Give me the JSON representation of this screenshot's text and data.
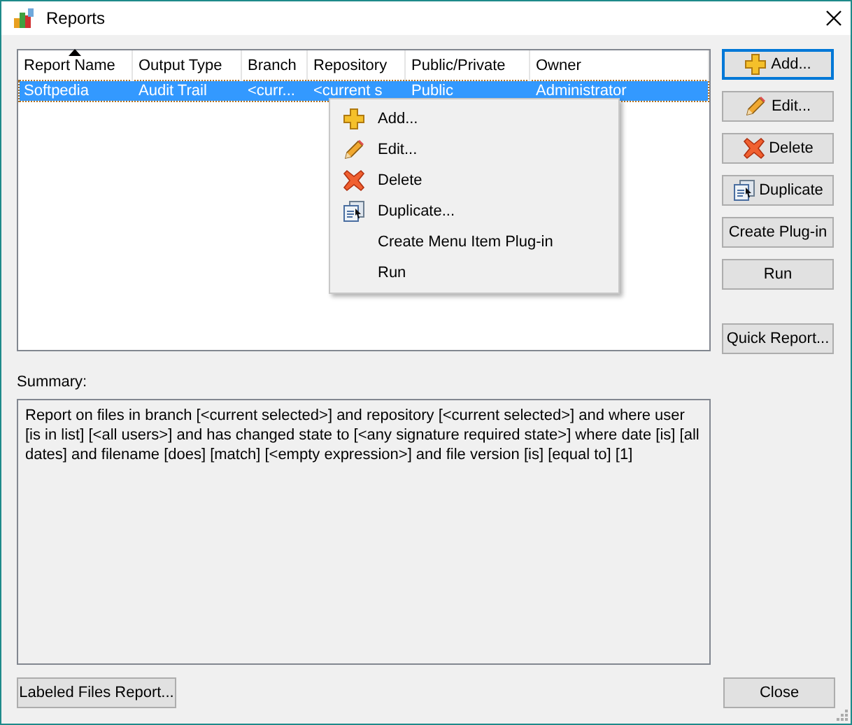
{
  "window": {
    "title": "Reports"
  },
  "table": {
    "columns": [
      {
        "label": "Report Name",
        "sorted": true
      },
      {
        "label": "Output Type",
        "sorted": false
      },
      {
        "label": "Branch",
        "sorted": false
      },
      {
        "label": "Repository",
        "sorted": false
      },
      {
        "label": "Public/Private",
        "sorted": false
      },
      {
        "label": "Owner",
        "sorted": false
      }
    ],
    "rows": [
      {
        "selected": true,
        "cells": [
          "Softpedia",
          "Audit Trail",
          "<curr...",
          "<current s",
          "Public",
          "Administrator"
        ]
      }
    ]
  },
  "context_menu": [
    {
      "label": "Add...",
      "kind": "add"
    },
    {
      "label": "Edit...",
      "kind": "edit"
    },
    {
      "label": "Delete",
      "kind": "delete"
    },
    {
      "label": "Duplicate...",
      "kind": "duplicate"
    },
    {
      "label": "Create Menu Item Plug-in",
      "kind": "plain"
    },
    {
      "label": "Run",
      "kind": "plain"
    }
  ],
  "side_buttons": [
    {
      "label": "Add...",
      "kind": "add",
      "focused": true
    },
    {
      "label": "Edit...",
      "kind": "edit",
      "focused": false
    },
    {
      "label": "Delete",
      "kind": "delete",
      "focused": false
    },
    {
      "label": "Duplicate",
      "kind": "duplicate",
      "focused": false
    },
    {
      "label": "Create Plug-in",
      "kind": "plain",
      "focused": false
    },
    {
      "label": "Run",
      "kind": "plain",
      "focused": false
    },
    {
      "label": "Quick Report...",
      "kind": "spaced",
      "focused": false
    }
  ],
  "summary": {
    "label": "Summary:",
    "text": "Report on files in branch [<current selected>] and repository [<current selected>] and where user [is in list] [<all users>] and has changed state to [<any signature required state>] where date [is] [all dates] and filename [does] [match] [<empty expression>] and file version [is] [equal to] [1]"
  },
  "bottom_buttons": [
    "Labeled Files Report...",
    "Close"
  ]
}
